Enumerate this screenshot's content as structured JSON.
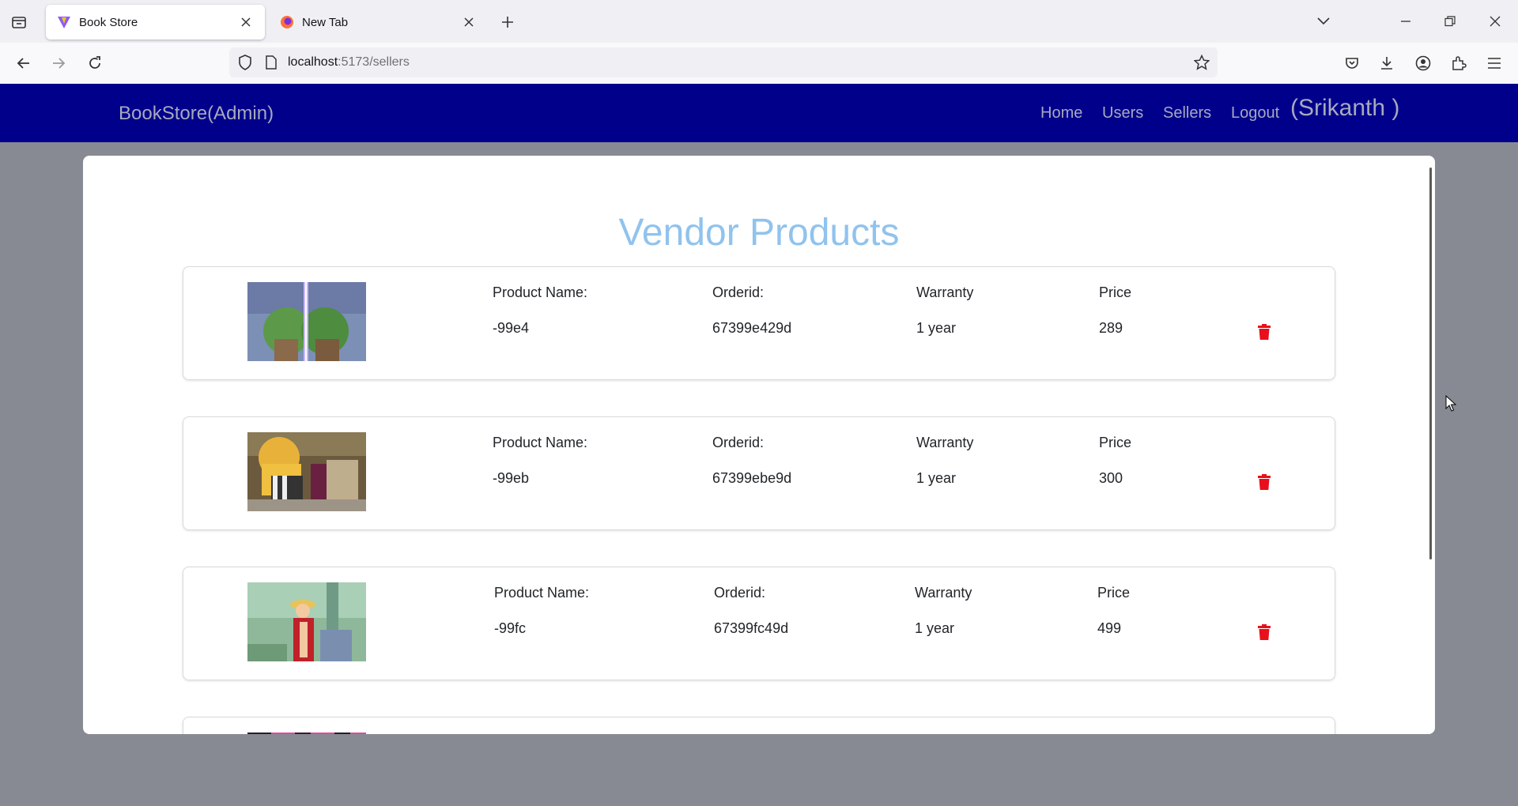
{
  "browser": {
    "tabs": [
      {
        "title": "Book Store",
        "active": true
      },
      {
        "title": "New Tab",
        "active": false
      }
    ],
    "url": {
      "host": "localhost",
      "path": ":5173/sellers"
    }
  },
  "app": {
    "brand": "BookStore(Admin)",
    "nav": [
      "Home",
      "Users",
      "Sellers",
      "Logout"
    ],
    "user": "(Srikanth )"
  },
  "page": {
    "title": "Vendor Products",
    "labels": {
      "name": "Product Name:",
      "orderid": "Orderid:",
      "warranty": "Warranty",
      "price": "Price"
    },
    "products": [
      {
        "name": "-99e4",
        "orderid": "67399e429d",
        "warranty": "1 year",
        "price": "289"
      },
      {
        "name": "-99eb",
        "orderid": "67399ebe9d",
        "warranty": "1 year",
        "price": "300"
      },
      {
        "name": "-99fc",
        "orderid": "67399fc49d",
        "warranty": "1 year",
        "price": "499"
      }
    ]
  },
  "colors": {
    "navbar": "#00008b",
    "title": "#90c3ee",
    "trash": "#e8101c"
  }
}
